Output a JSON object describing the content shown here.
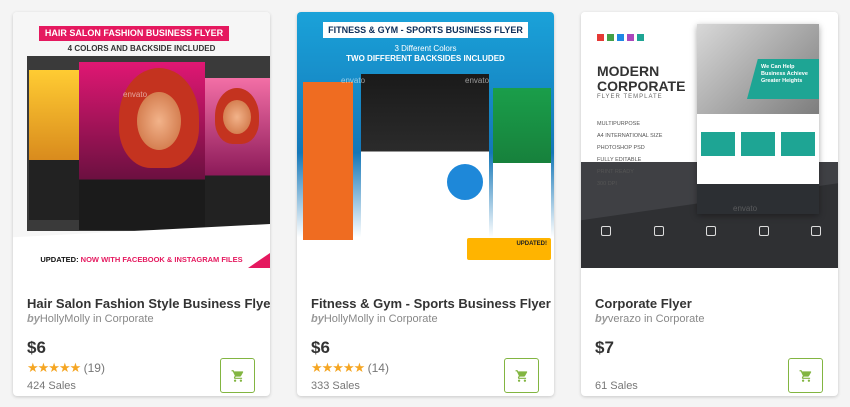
{
  "cards": [
    {
      "title": "Hair Salon Fashion Style Business Flyer",
      "by": "by",
      "author": "HollyMolly",
      "in": "in",
      "category": "Corporate",
      "price": "$6",
      "rating_count": "(19)",
      "sales": "424 Sales",
      "thumb": {
        "banner": "HAIR SALON FASHION BUSINESS FLYER",
        "subtitle": "4 COLORS AND BACKSIDE INCLUDED",
        "updated_prefix": "UPDATED:",
        "updated_text": "NOW WITH FACEBOOK & INSTAGRAM FILES"
      }
    },
    {
      "title": "Fitness & Gym - Sports Business Flyer",
      "by": "by",
      "author": "HollyMolly",
      "in": "in",
      "category": "Corporate",
      "price": "$6",
      "rating_count": "(14)",
      "sales": "333 Sales",
      "thumb": {
        "banner": "FITNESS & GYM - SPORTS BUSINESS FLYER",
        "subtitle1": "3 Different Colors",
        "subtitle2": "TWO DIFFERENT BACKSIDES INCLUDED",
        "updated": "UPDATED!"
      }
    },
    {
      "title": "Corporate Flyer",
      "by": "by",
      "author": "verazo",
      "in": "in",
      "category": "Corporate",
      "price": "$7",
      "rating_count": "",
      "sales": "61 Sales",
      "thumb": {
        "heading1": "MODERN",
        "heading2": "CORPORATE",
        "heading3": "FLYER TEMPLATE",
        "features": [
          "MULTIPURPOSE",
          "A4 INTERNATIONAL SIZE",
          "PHOTOSHOP PSD",
          "FULLY EDITABLE",
          "PRINT READY",
          "300 DPI"
        ],
        "flyer_tagline": "We Can Help Business Achieve Greater Heights"
      }
    }
  ],
  "stars_glyph": "★★★★★",
  "watermark": "envato",
  "colors": {
    "cart_green": "#82b541",
    "star": "#f5a623",
    "pink": "#e5195f"
  }
}
